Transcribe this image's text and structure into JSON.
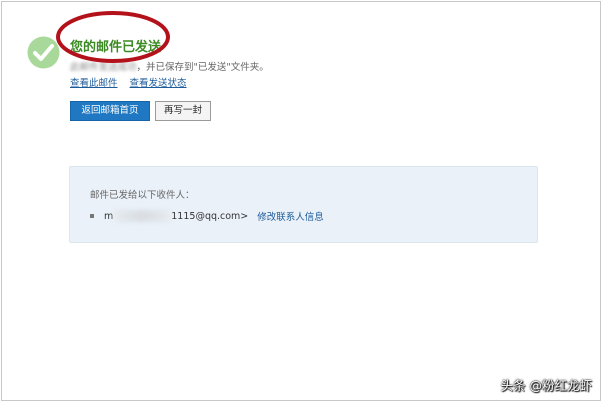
{
  "status": {
    "title": "您的邮件已发送",
    "subtitle_start": "此邮件发送成功",
    "subtitle_end": "，并已保存到\"已发送\"文件夹。"
  },
  "links": {
    "view_mail": "查看此邮件",
    "view_status": "查看发送状态"
  },
  "buttons": {
    "back_to_inbox": "返回邮箱首页",
    "write_another": "再写一封"
  },
  "recipients": {
    "header": "邮件已发给以下收件人：",
    "list": [
      {
        "prefix": "m",
        "email": "1115@qq.com>",
        "edit_label": "修改联系人信息"
      }
    ]
  },
  "watermark": "头条 @粉红龙虾",
  "colors": {
    "success_green": "#3b8a24",
    "check_circle": "#a9d99a",
    "annotation_red": "#b4121b",
    "primary_blue": "#1f78c1",
    "link_blue": "#1d5b9a",
    "panel_bg": "#eaf1f8"
  }
}
